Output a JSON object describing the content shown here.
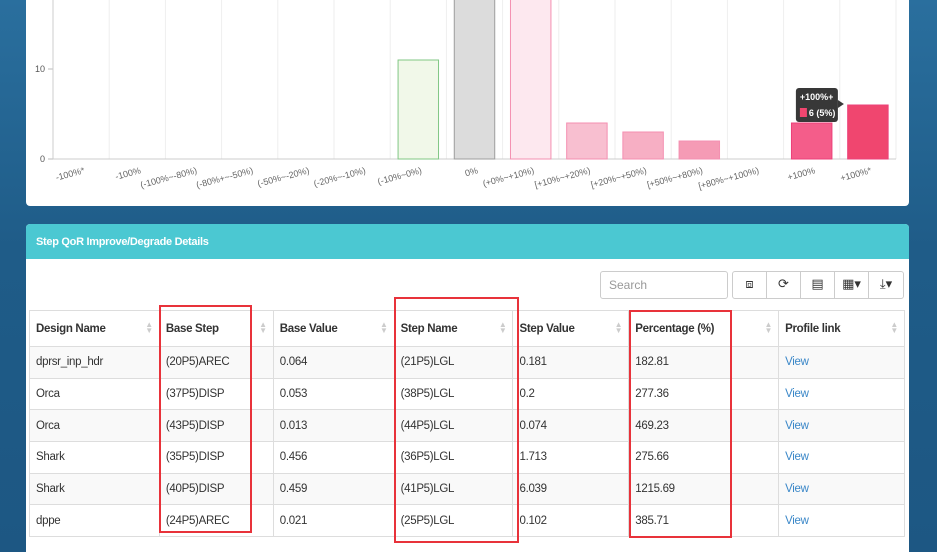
{
  "chart_data": {
    "type": "bar",
    "categories": [
      "-100%*",
      "-100%",
      "(-100%~-80%)",
      "(-80%+~-50%)",
      "(-50%~-20%)",
      "(-20%~-10%)",
      "(-10%~0%)",
      "0%",
      "(+0%~+10%)",
      "[+10%~+20%)",
      "[+20%~+50%)",
      "[+50%~+80%)",
      "[+80%~+100%)",
      "+100%",
      "+100%*"
    ],
    "values": [
      0,
      0,
      0,
      0,
      0,
      0,
      11,
      26,
      22,
      4,
      3,
      2,
      0,
      4,
      6
    ],
    "colors": [
      "#c8e6c9",
      "#c8e6c9",
      "#c8e6c9",
      "#c8e6c9",
      "#c8e6c9",
      "#c8e6c9",
      "#f1f8e9",
      "#dcdcdc",
      "#fde8ef",
      "#f8bfd0",
      "#f7afc4",
      "#f59bb5",
      "#f487a8",
      "#f45d8a",
      "#f0466f"
    ],
    "strokes": [
      "#81c784",
      "#81c784",
      "#81c784",
      "#81c784",
      "#81c784",
      "#81c784",
      "#81c784",
      "#9e9e9e",
      "#f48fb1",
      "#f48fb1",
      "#f48fb1",
      "#f48fb1",
      "#f48fb1",
      "#ec407a",
      "#ec407a"
    ],
    "yticks": [
      "0",
      "10"
    ],
    "ylim": [
      0,
      18
    ],
    "tooltip": {
      "title": "+100%+",
      "value": "6 (5%)",
      "swatch": "#f0466f"
    }
  },
  "details": {
    "title": "Step QoR Improve/Degrade Details",
    "search_placeholder": "Search",
    "tools": {
      "toggle": "⧈",
      "refresh": "⟳",
      "export_doc": "▤",
      "columns": "▦▾",
      "download": "⤓▾"
    },
    "columns": [
      "Design Name",
      "Base Step",
      "Base Value",
      "Step Name",
      "Step Value",
      "Percentage (%)",
      "Profile link"
    ],
    "rows": [
      [
        "dprsr_inp_hdr",
        "(20P5)AREC",
        "0.064",
        "(21P5)LGL",
        "0.181",
        "182.81",
        "View"
      ],
      [
        "Orca",
        "(37P5)DISP",
        "0.053",
        "(38P5)LGL",
        "0.2",
        "277.36",
        "View"
      ],
      [
        "Orca",
        "(43P5)DISP",
        "0.013",
        "(44P5)LGL",
        "0.074",
        "469.23",
        "View"
      ],
      [
        "Shark",
        "(35P5)DISP",
        "0.456",
        "(36P5)LGL",
        "1.713",
        "275.66",
        "View"
      ],
      [
        "Shark",
        "(40P5)DISP",
        "0.459",
        "(41P5)LGL",
        "6.039",
        "1215.69",
        "View"
      ],
      [
        "dppe",
        "(24P5)AREC",
        "0.021",
        "(25P5)LGL",
        "0.102",
        "385.71",
        "View"
      ]
    ],
    "highlight_color": "#e8323a"
  }
}
